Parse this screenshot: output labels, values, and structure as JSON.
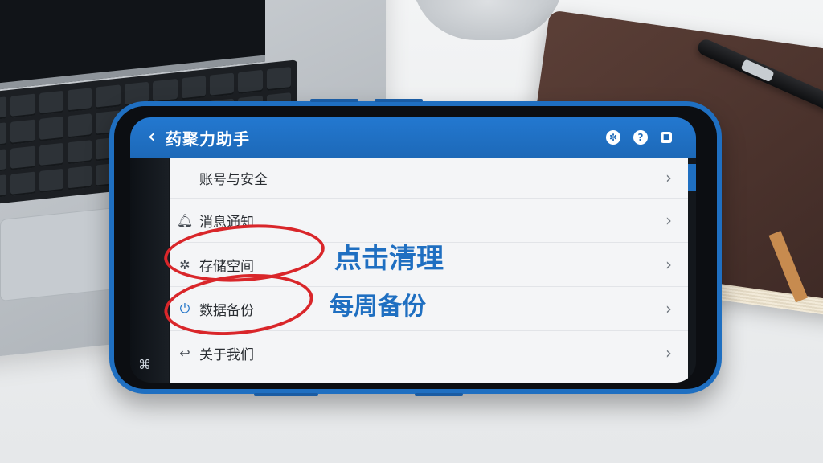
{
  "app": {
    "title": "药聚力助手",
    "back_icon": "chevron-left-icon"
  },
  "header_icons": [
    "settings-icon",
    "help-icon",
    "lock-icon"
  ],
  "settings": {
    "items": [
      {
        "label": "账号与安全",
        "icon": ""
      },
      {
        "label": "消息通知",
        "icon": "bell-icon"
      },
      {
        "label": "存储空间",
        "icon": "storage-icon"
      },
      {
        "label": "数据备份",
        "icon": "backup-icon"
      },
      {
        "label": "关于我们",
        "icon": "about-icon"
      }
    ]
  },
  "annotations": {
    "storage_note": "点击清理",
    "backup_note": "每周备份",
    "circle_color": "#d9262a",
    "text_color": "#1f6fc1"
  },
  "colors": {
    "accent": "#1f6fc1",
    "header": "#1d69b8"
  }
}
